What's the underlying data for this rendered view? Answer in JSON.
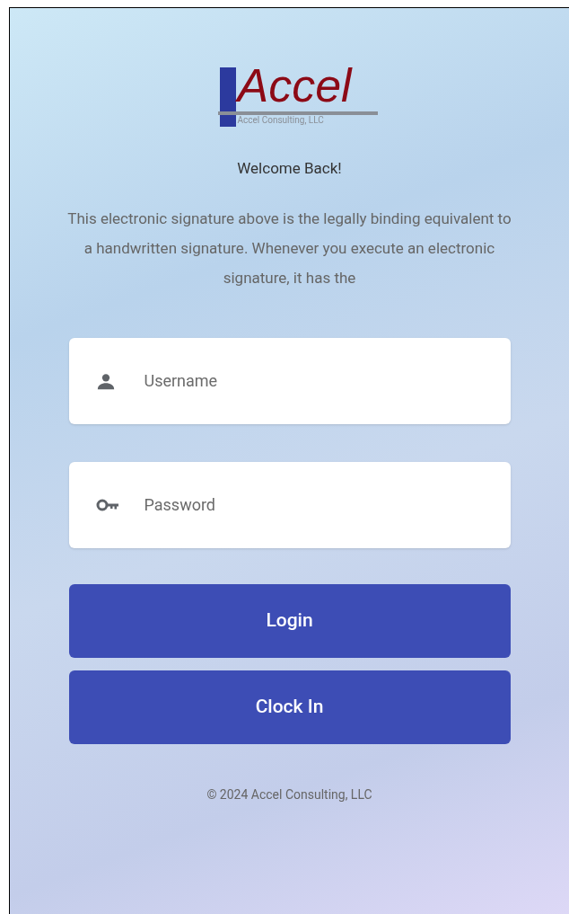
{
  "logo": {
    "name": "Accel",
    "tagline": "Accel Consulting, LLC"
  },
  "welcome": "Welcome Back!",
  "description": "This electronic signature above is the legally binding equivalent to a handwritten signature. Whenever you execute an electronic signature, it has the",
  "fields": [
    {
      "kind": "user",
      "placeholder": "Username"
    },
    {
      "kind": "password",
      "placeholder": "Password"
    }
  ],
  "buttons": [
    "Login",
    "Clock In"
  ],
  "footer": "© 2024 Accel Consulting, LLC"
}
